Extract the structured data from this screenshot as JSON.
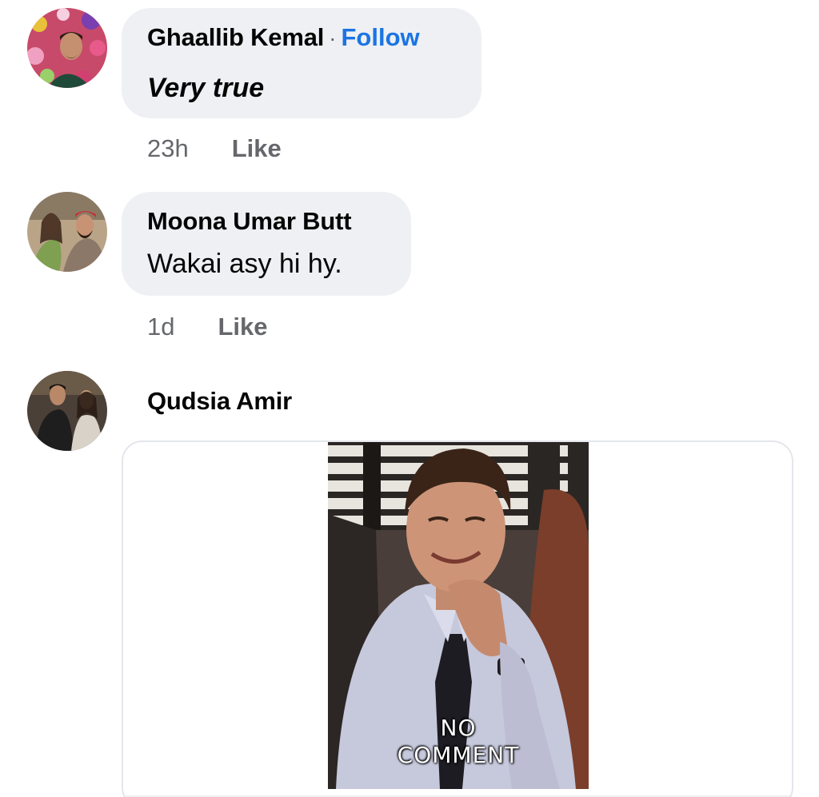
{
  "comments": [
    {
      "author": "Ghaallib Kemal",
      "separator": "·",
      "follow_label": "Follow",
      "text": "Very true",
      "time": "23h",
      "like_label": "Like"
    },
    {
      "author": "Moona Umar Butt",
      "text": "Wakai asy hi hy.",
      "time": "1d",
      "like_label": "Like"
    },
    {
      "author": "Qudsia Amir",
      "gif": {
        "caption_line1": "NO",
        "caption_line2": "COMMENT"
      }
    }
  ],
  "colors": {
    "accent": "#1b74e4",
    "bubble": "#eef0f3",
    "meta_text": "#65676b"
  }
}
